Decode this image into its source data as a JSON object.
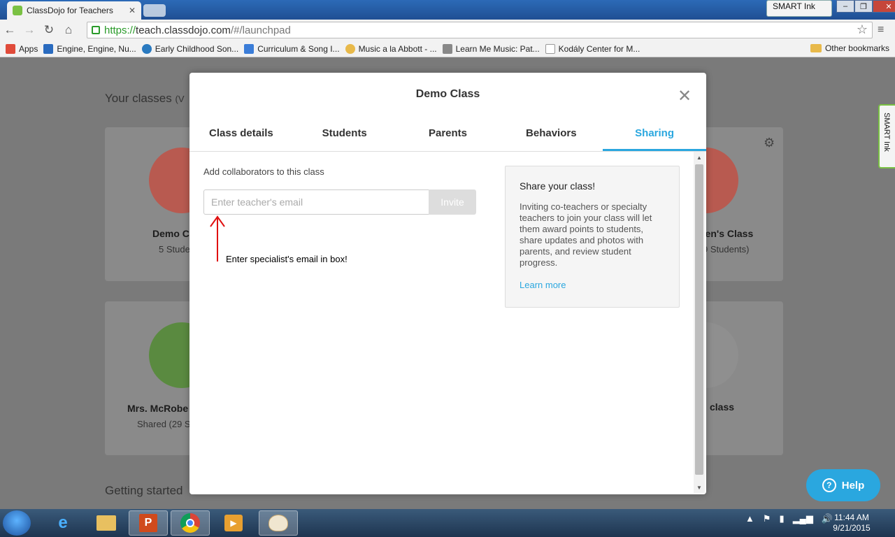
{
  "browser": {
    "tab_title": "ClassDojo for Teachers",
    "smart_ink_label": "SMART Ink",
    "url_scheme": "https://",
    "url_host": "teach.classdojo.com",
    "url_path": "/#/launchpad"
  },
  "bookmarks": [
    {
      "label": "Apps",
      "color": "#e04b3a"
    },
    {
      "label": "Engine, Engine, Nu...",
      "color": "#2a6bbf"
    },
    {
      "label": "Early Childhood Son...",
      "color": "#2a7ac0"
    },
    {
      "label": "Curriculum & Song I...",
      "color": "#3b7dd8"
    },
    {
      "label": "Music a la Abbott - ...",
      "color": "#e8b94a"
    },
    {
      "label": "Learn Me Music: Pat...",
      "color": "#888888"
    },
    {
      "label": "Kodály Center for M...",
      "color": "#cccccc"
    }
  ],
  "other_bookmarks": "Other bookmarks",
  "background_page": {
    "heading": "Your classes",
    "heading_suffix": "(V",
    "getting_started": "Getting started",
    "cards": [
      {
        "name": "Demo C",
        "sub": "5 Stude"
      },
      {
        "name": "hen's Class",
        "sub": "9 Students)"
      },
      {
        "name": "Mrs. McRobe",
        "sub": "Shared (29 S"
      },
      {
        "name": "class",
        "sub": ""
      }
    ]
  },
  "modal": {
    "title": "Demo Class",
    "tabs": [
      "Class details",
      "Students",
      "Parents",
      "Behaviors",
      "Sharing"
    ],
    "active_tab": "Sharing",
    "collab_label": "Add collaborators to this class",
    "email_placeholder": "Enter teacher's email",
    "invite_label": "Invite",
    "annotation": "Enter specialist's email in box!",
    "share_panel": {
      "title": "Share your class!",
      "body": "Inviting co-teachers or specialty teachers to join your class will let them award points to students, share updates and photos with parents, and review student progress.",
      "link": "Learn more"
    }
  },
  "help_label": "Help",
  "clock": {
    "time": "11:44 AM",
    "date": "9/21/2015"
  },
  "colors": {
    "accent": "#2aa7df",
    "brand_green": "#7ac143"
  }
}
